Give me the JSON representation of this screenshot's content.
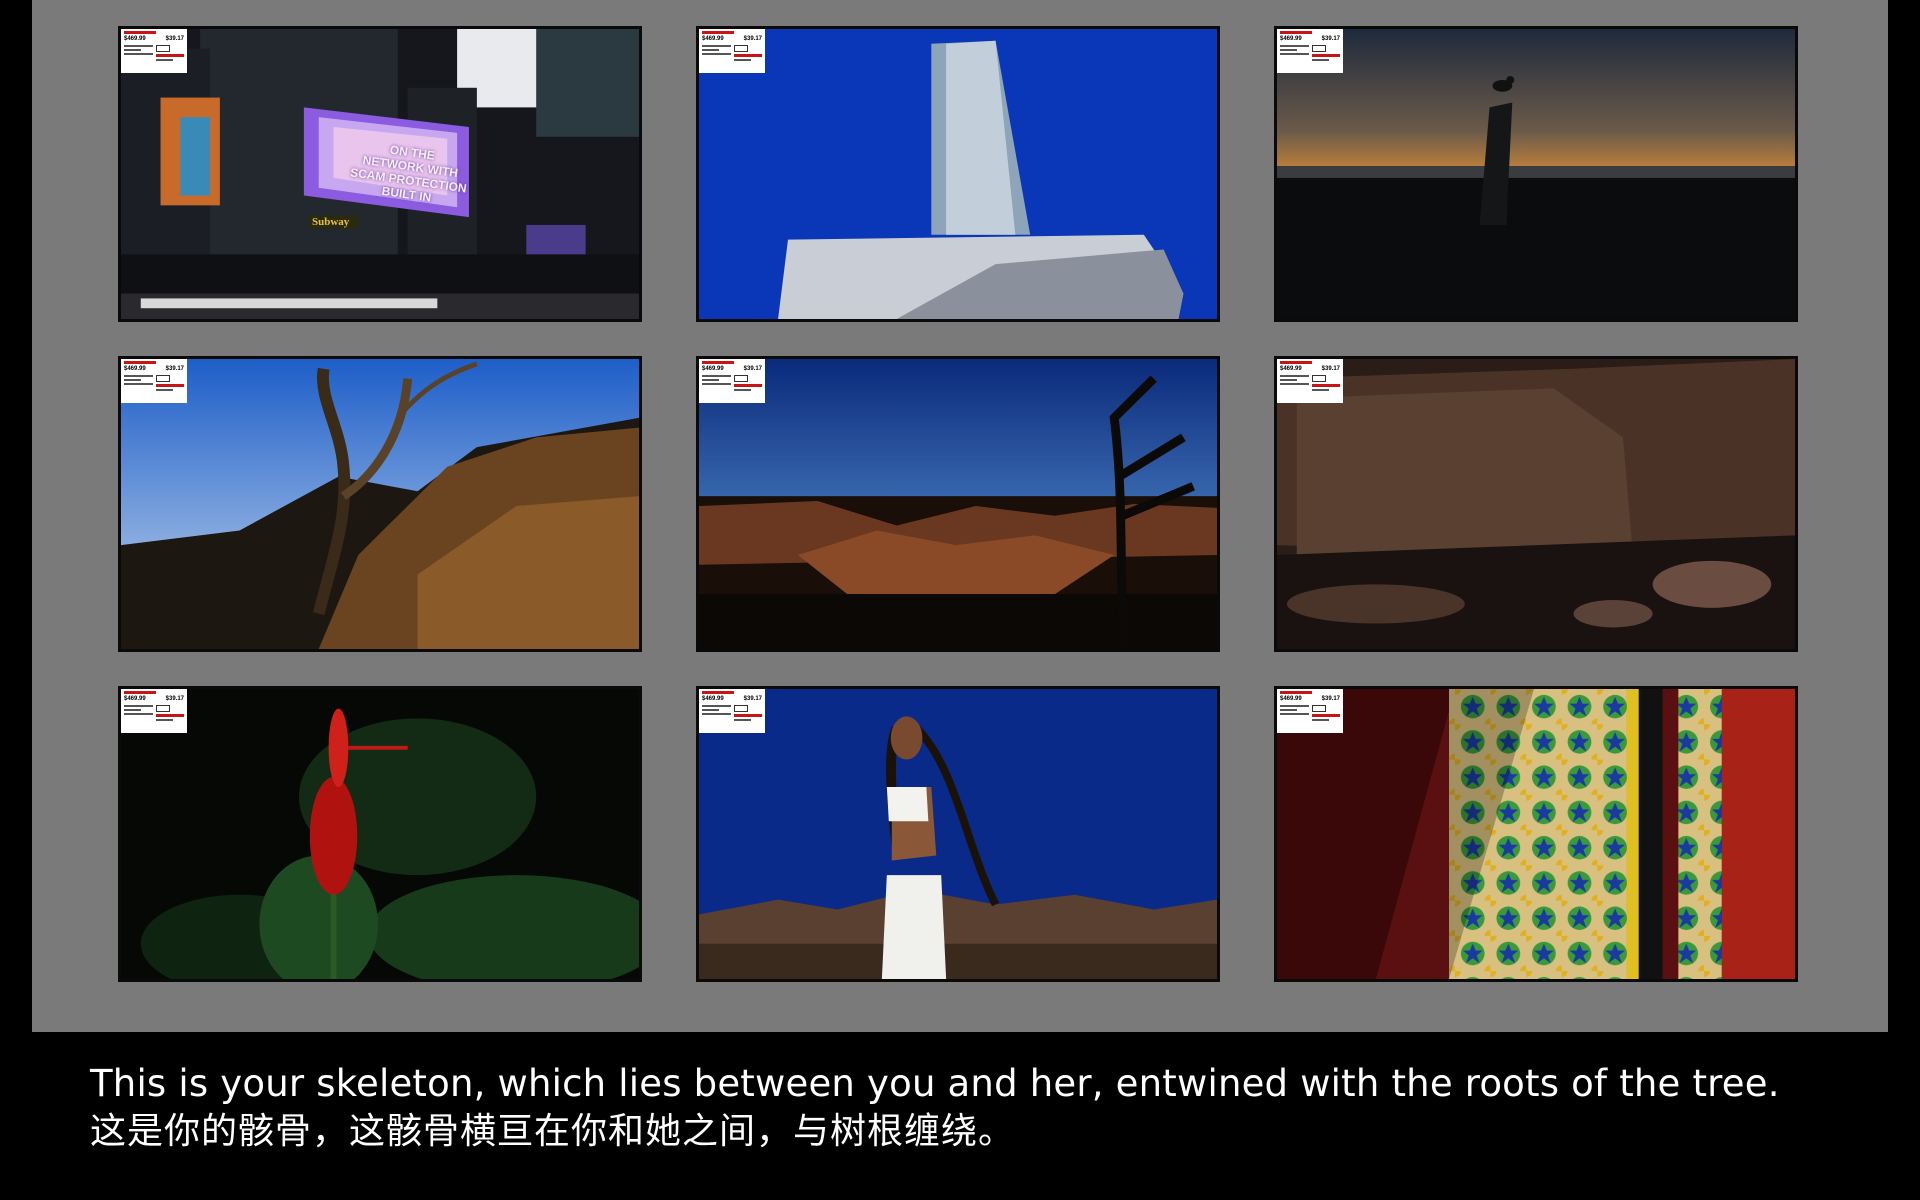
{
  "caption": {
    "english": "This is your skeleton, which lies between you and her, entwined with the roots of the tree.",
    "chinese": "这是你的骸骨，这骸骨横亘在你和她之间，与树根缠绕。"
  },
  "price_tag": {
    "price_a": "$469.99",
    "price_b": "$39.17"
  },
  "billboard": {
    "lines": [
      "ON THE",
      "NETWORK WITH",
      "SCAM PROTECTION",
      "BUILT IN"
    ],
    "store_sign": "Subway"
  },
  "thumbnails": [
    {
      "id": "city-billboard",
      "subject": "street-billboard"
    },
    {
      "id": "tower-blue-sky",
      "subject": "tower"
    },
    {
      "id": "bird-sunset",
      "subject": "bird"
    },
    {
      "id": "tree-hillside",
      "subject": "tree"
    },
    {
      "id": "canyon-dusk",
      "subject": "canyon"
    },
    {
      "id": "rock-cliff",
      "subject": "cliff"
    },
    {
      "id": "red-flower",
      "subject": "flower"
    },
    {
      "id": "woman-desert",
      "subject": "portrait"
    },
    {
      "id": "tile-wall",
      "subject": "tiles"
    }
  ],
  "colors": {
    "panel_bg": "#7a7a7a",
    "page_bg": "#000000",
    "caption_text": "#ffffff",
    "tag_accent": "#c81414"
  }
}
